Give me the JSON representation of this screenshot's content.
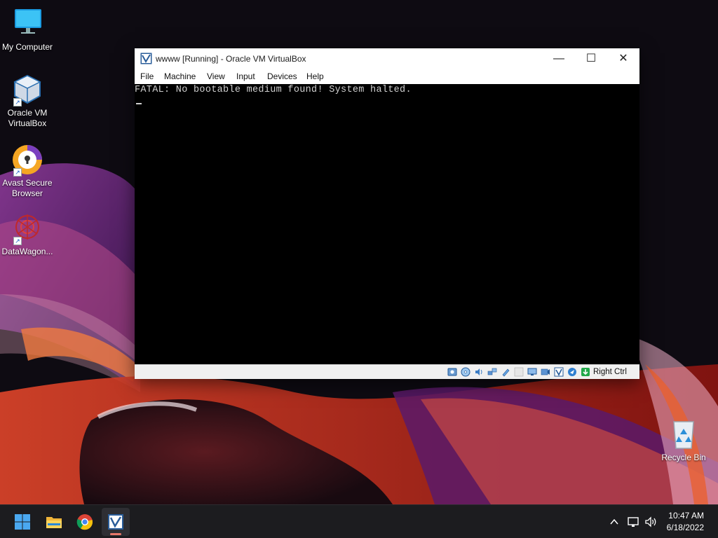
{
  "desktop": {
    "icons": [
      {
        "label": "My Computer",
        "icon": "monitor-icon"
      },
      {
        "label": "Oracle VM VirtualBox",
        "icon": "virtualbox-cube-icon"
      },
      {
        "label": "Avast Secure Browser",
        "icon": "avast-browser-icon"
      },
      {
        "label": "DataWagon...",
        "icon": "datawagon-icon"
      },
      {
        "label": "Recycle Bin",
        "icon": "recycle-bin-icon"
      }
    ]
  },
  "window": {
    "title": "wwww [Running] - Oracle VM VirtualBox",
    "controls": {
      "minimize": "—",
      "maximize": "☐",
      "close": "✕"
    },
    "menu": [
      "File",
      "Machine",
      "View",
      "Input",
      "Devices",
      "Help"
    ],
    "console": {
      "message": "FATAL: No bootable medium found! System halted."
    },
    "statusbar": {
      "icons": [
        "hard-disk-icon",
        "optical-drive-icon",
        "audio-icon",
        "network-icon",
        "usb-icon",
        "shared-folders-icon",
        "display-icon",
        "video-capture-icon",
        "virtualization-icon",
        "mouse-integration-icon",
        "keyboard-capture-icon"
      ],
      "host_key": "Right Ctrl"
    }
  },
  "taskbar": {
    "apps": [
      "start-button",
      "file-explorer",
      "chrome",
      "virtualbox"
    ],
    "tray": [
      "show-hidden-icons",
      "network-icon",
      "volume-icon"
    ],
    "clock": {
      "time": "10:47 AM",
      "date": "6/18/2022"
    }
  },
  "colors": {
    "taskbar": "#1c1c1f",
    "console_bg": "#000000",
    "console_text": "#cfcfcf",
    "wallpaper_red": "#c8281e",
    "wallpaper_purple": "#6a2a7a"
  }
}
